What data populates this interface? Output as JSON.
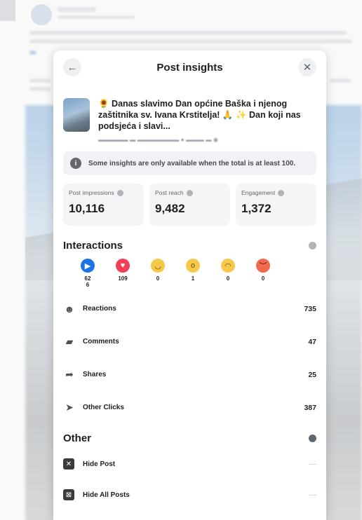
{
  "modal": {
    "title": "Post insights"
  },
  "post": {
    "caption": "🌻 Danas slavimo Dan općine Baška i njenog zaštitnika sv. Ivana Krstitelja! 🙏 ✨ Dan koji nas podsjeća i slavi..."
  },
  "notice": {
    "text": "Some insights are only available when the total is at least 100."
  },
  "metrics": [
    {
      "label": "Post impressions",
      "value": "10,116"
    },
    {
      "label": "Post reach",
      "value": "9,482"
    },
    {
      "label": "Engagement",
      "value": "1,372"
    }
  ],
  "interactions": {
    "title": "Interactions",
    "reactions": [
      {
        "icon": "like-icon",
        "count": "62\n6"
      },
      {
        "icon": "love-icon",
        "count": "109"
      },
      {
        "icon": "haha-icon",
        "count": "0"
      },
      {
        "icon": "wow-icon",
        "count": "1"
      },
      {
        "icon": "sad-icon",
        "count": "0"
      },
      {
        "icon": "angry-icon",
        "count": "0"
      }
    ],
    "stats": [
      {
        "icon": "reactions-icon",
        "label": "Reactions",
        "value": "735"
      },
      {
        "icon": "comments-icon",
        "label": "Comments",
        "value": "47"
      },
      {
        "icon": "shares-icon",
        "label": "Shares",
        "value": "25"
      },
      {
        "icon": "clicks-icon",
        "label": "Other Clicks",
        "value": "387"
      }
    ]
  },
  "other": {
    "title": "Other",
    "items": [
      {
        "label": "Hide Post",
        "value": "—"
      },
      {
        "label": "Hide All Posts",
        "value": "—"
      }
    ]
  }
}
